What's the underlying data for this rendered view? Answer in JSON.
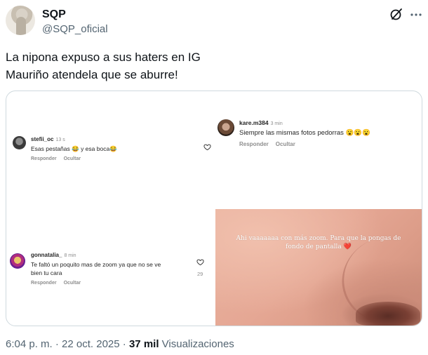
{
  "author": {
    "name": "SQP",
    "handle": "@SQP_oficial"
  },
  "tweet": {
    "line1": "La nipona expuso a sus haters en IG",
    "line2": "Mauriño atendela que se aburre!"
  },
  "comments": [
    {
      "user": "stefii_oc",
      "time": "13 s",
      "text": "Esas pestañas 😂 y esa boca😂",
      "reply": "Responder",
      "hide": "Ocultar"
    },
    {
      "user": "kare.m384",
      "time": "3 min",
      "text": "Siempre las mismas fotos pedorras 😮😮😮",
      "reply": "Responder",
      "hide": "Ocultar"
    },
    {
      "user": "gonnatalia_",
      "time": "8 min",
      "text_line1": "Te faltó un poquito mas de zoom ya que no se ve",
      "text_line2": "bien tu cara",
      "likes": "29",
      "reply": "Responder",
      "hide": "Ocultar"
    }
  ],
  "photo_caption": {
    "line1": "Ahi vaaaaaaa con más zoom. Para que la pongas de",
    "line2": "fondo de pantalla",
    "emoji": "❤️"
  },
  "footer": {
    "time": "6:04 p. m.",
    "sep1": " · ",
    "date": "22 oct. 2025",
    "sep2": " · ",
    "views": "37 mil",
    "views_label": " Visualizaciones"
  },
  "icons": {
    "grok": "grok-icon",
    "more": "more-icon",
    "heart": "heart-icon"
  }
}
